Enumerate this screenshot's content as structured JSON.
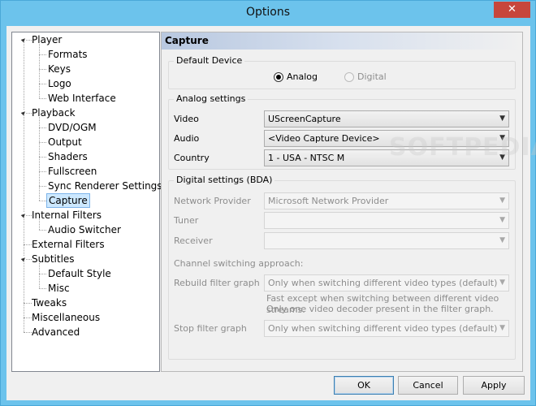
{
  "window": {
    "title": "Options",
    "close_glyph": "✕"
  },
  "tree": {
    "items": [
      {
        "label": "Player",
        "level": 0,
        "expanded": true
      },
      {
        "label": "Formats",
        "level": 1
      },
      {
        "label": "Keys",
        "level": 1
      },
      {
        "label": "Logo",
        "level": 1
      },
      {
        "label": "Web Interface",
        "level": 1
      },
      {
        "label": "Playback",
        "level": 0,
        "expanded": true
      },
      {
        "label": "DVD/OGM",
        "level": 1
      },
      {
        "label": "Output",
        "level": 1
      },
      {
        "label": "Shaders",
        "level": 1
      },
      {
        "label": "Fullscreen",
        "level": 1
      },
      {
        "label": "Sync Renderer Settings",
        "level": 1
      },
      {
        "label": "Capture",
        "level": 1,
        "selected": true
      },
      {
        "label": "Internal Filters",
        "level": 0,
        "expanded": true
      },
      {
        "label": "Audio Switcher",
        "level": 1
      },
      {
        "label": "External Filters",
        "level": 0
      },
      {
        "label": "Subtitles",
        "level": 0,
        "expanded": true
      },
      {
        "label": "Default Style",
        "level": 1
      },
      {
        "label": "Misc",
        "level": 1
      },
      {
        "label": "Tweaks",
        "level": 0
      },
      {
        "label": "Miscellaneous",
        "level": 0
      },
      {
        "label": "Advanced",
        "level": 0
      }
    ]
  },
  "panel": {
    "title": "Capture",
    "default_device": {
      "group_title": "Default Device",
      "analog_label": "Analog",
      "digital_label": "Digital",
      "selected": "Analog"
    },
    "analog": {
      "group_title": "Analog settings",
      "video_label": "Video",
      "video_value": "UScreenCapture",
      "audio_label": "Audio",
      "audio_value": "<Video Capture Device>",
      "country_label": "Country",
      "country_value": "1 - USA - NTSC M"
    },
    "digital": {
      "group_title": "Digital settings (BDA)",
      "network_provider_label": "Network Provider",
      "network_provider_value": "Microsoft Network Provider",
      "tuner_label": "Tuner",
      "tuner_value": "",
      "receiver_label": "Receiver",
      "receiver_value": "",
      "channel_switching_label": "Channel switching approach:",
      "rebuild_label": "Rebuild filter graph",
      "rebuild_value": "Only when switching different video types (default)",
      "rebuild_note_1": "Fast except when switching between different video streams.",
      "rebuild_note_2": "Only one video decoder present in the filter graph.",
      "stop_label": "Stop filter graph",
      "stop_value": "Only when switching different video types (default)"
    }
  },
  "buttons": {
    "ok": "OK",
    "cancel": "Cancel",
    "apply": "Apply"
  },
  "watermark": "SOFTPEDIA"
}
